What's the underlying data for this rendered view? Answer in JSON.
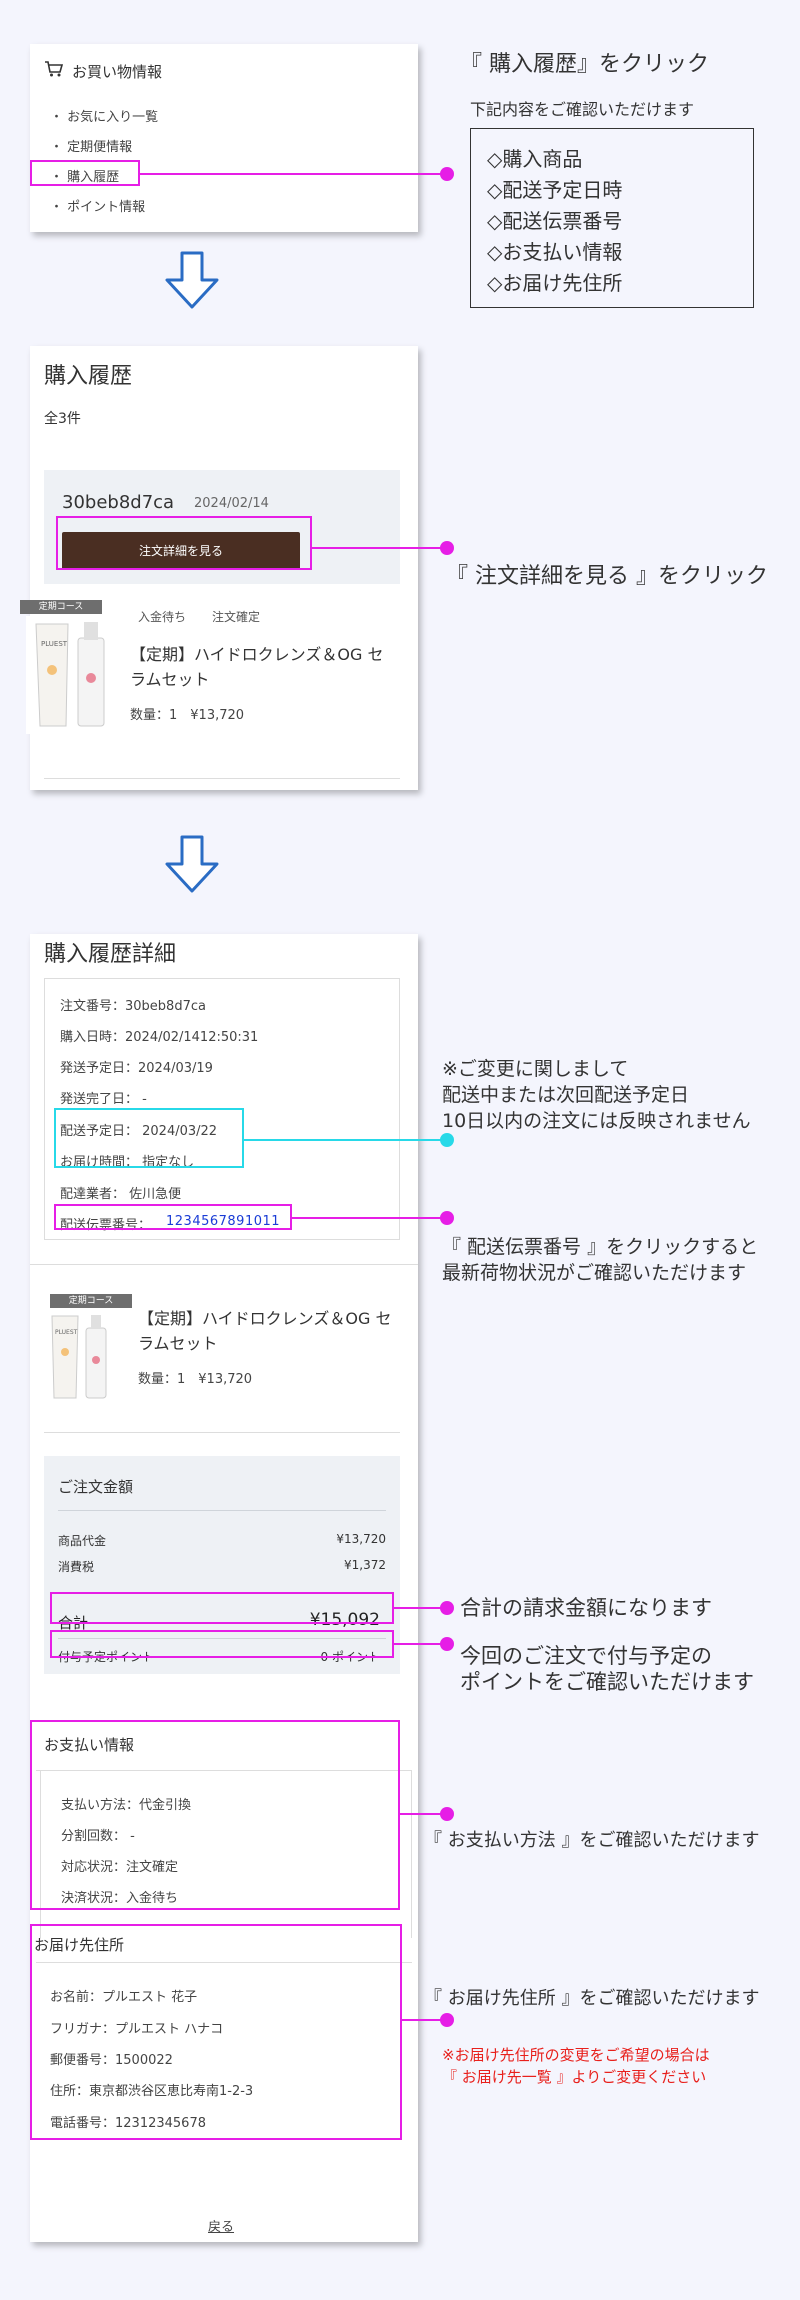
{
  "menu": {
    "title": "お買い物情報",
    "items": [
      "・ お気に入り一覧",
      "・ 定期便情報",
      "・ 購入履歴",
      "・ ポイント情報"
    ]
  },
  "callout1": {
    "title": "『 購入履歴』をクリック",
    "subtitle": "下記内容をご確認いただけます",
    "list": [
      "◇購入商品",
      "◇配送予定日時",
      "◇配送伝票番号",
      "◇お支払い情報",
      "◇お届け先住所"
    ]
  },
  "history": {
    "title": "購入履歴",
    "count": "全3件",
    "order_id": "30beb8d7ca",
    "order_date": "2024/02/14",
    "detail_button": "注文詳細を見る",
    "badge": "定期コース",
    "status_payment": "入金待ち",
    "status_order": "注文確定",
    "product_name": "【定期】ハイドロクレンズ＆OG セラムセット",
    "quantity_price": "数量：1　¥13,720"
  },
  "callout2": {
    "text": "『 注文詳細を見る 』をクリック"
  },
  "detail": {
    "title": "購入履歴詳細",
    "order_number": "注文番号：30beb8d7ca",
    "purchase_datetime": "購入日時：2024/02/1412:50:31",
    "ship_scheduled": "発送予定日：2024/03/19",
    "ship_completed": "発送完了日： -",
    "delivery_date": "配送予定日： 2024/03/22",
    "delivery_time": "お届け時間： 指定なし",
    "carrier": "配達業者： 佐川急便",
    "tracking_label": "配送伝票番号：",
    "tracking_number": "1234567891011",
    "badge": "定期コース",
    "product_name": "【定期】ハイドロクレンズ＆OG セラムセット",
    "quantity_price": "数量：1　¥13,720"
  },
  "amount": {
    "title": "ご注文金額",
    "subtotal_label": "商品代金",
    "subtotal_value": "¥13,720",
    "tax_label": "消費税",
    "tax_value": "¥1,372",
    "total_label": "合計",
    "total_value": "¥15,092",
    "points_label": "付与予定ポイント",
    "points_value": "0 ポイント"
  },
  "payment": {
    "title": "お支払い情報",
    "method": "支払い方法：代金引換",
    "installments": "分割回数： -",
    "status": "対応状況：注文確定",
    "settlement": "決済状況：入金待ち"
  },
  "address": {
    "title": "お届け先住所",
    "name": "お名前：プルエスト 花子",
    "furigana": "フリガナ：プルエスト ハナコ",
    "zip": "郵便番号：1500022",
    "addr": "住所：東京都渋谷区恵比寿南1-2-3",
    "phone": "電話番号：12312345678"
  },
  "back_link": "戻る",
  "notes": {
    "change_1": "※ご変更に関しまして",
    "change_2": "配送中または次回配送予定日",
    "change_3": "10日以内の注文には反映されません",
    "tracking_1": "『 配送伝票番号 』をクリックすると",
    "tracking_2": "最新荷物状況がご確認いただけます",
    "total": "合計の請求金額になります",
    "points_1": "今回のご注文で付与予定の",
    "points_2": "ポイントをご確認いただけます",
    "payment": "『 お支払い方法 』をご確認いただけます",
    "address": "『 お届け先住所 』をご確認いただけます",
    "address_warn_1": "※お届け先住所の変更をご希望の場合は",
    "address_warn_2": "『 お届け先一覧 』よりご変更ください"
  },
  "colors": {
    "magenta": "#e61ee6",
    "cyan": "#27d9e8",
    "button": "#4a2e22",
    "link": "#1a3cd6",
    "warn": "#e8201c"
  }
}
